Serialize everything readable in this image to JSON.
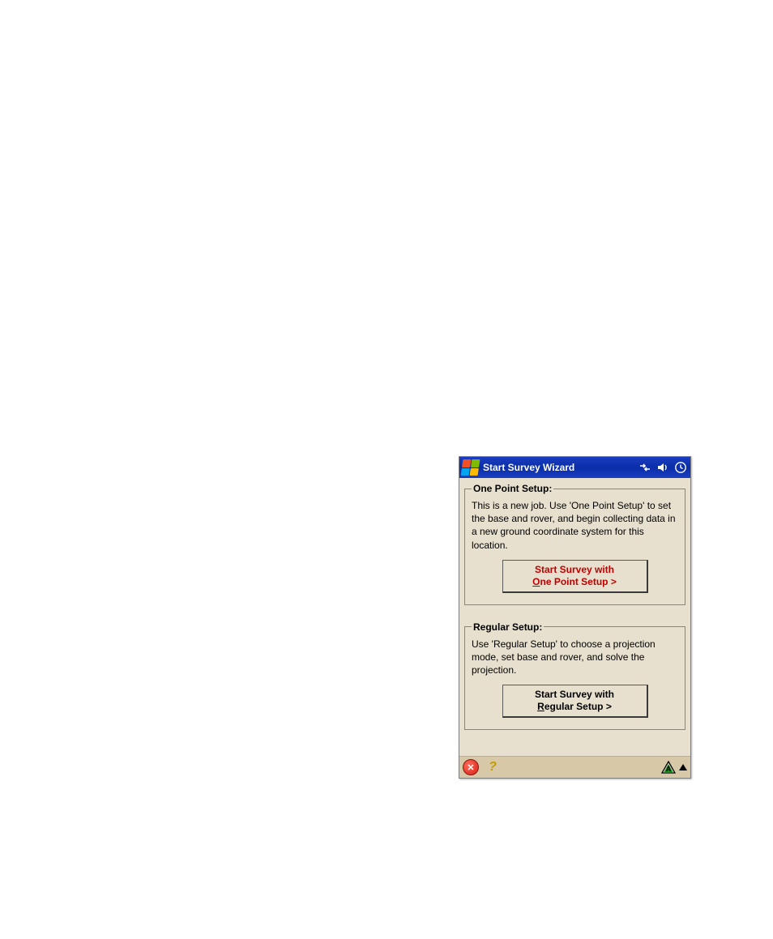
{
  "window": {
    "title": "Start Survey Wizard"
  },
  "sections": {
    "onePoint": {
      "legend": "One Point Setup:",
      "desc": "This is a new job. Use 'One Point Setup' to set the base and rover, and begin collecting data in a new ground coordinate system for this location.",
      "button_line1": "Start Survey with",
      "button_underline": "O",
      "button_rest": "ne Point Setup >"
    },
    "regular": {
      "legend": "Regular Setup:",
      "desc": "Use 'Regular Setup' to choose a projection mode, set base and rover, and solve the projection.",
      "button_line1": "Start Survey with",
      "button_underline": "R",
      "button_rest": "egular Setup >"
    }
  },
  "bottombar": {
    "close": "✕",
    "help": "?"
  }
}
